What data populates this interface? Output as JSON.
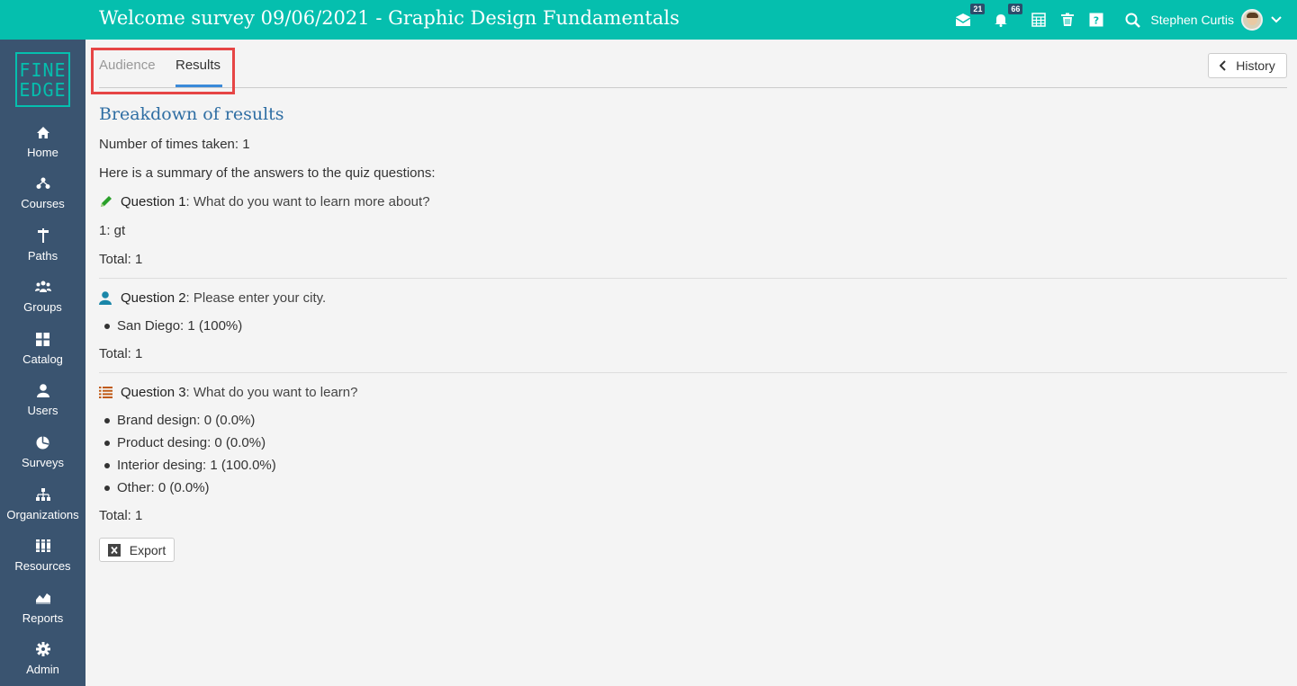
{
  "header": {
    "title": "Welcome survey 09/06/2021 - Graphic Design Fundamentals",
    "messages_badge": "21",
    "notifications_badge": "66",
    "user_name": "Stephen Curtis"
  },
  "logo": {
    "line1": "FINE",
    "line2": "EDGE"
  },
  "sidebar": {
    "items": [
      {
        "label": "Home"
      },
      {
        "label": "Courses"
      },
      {
        "label": "Paths"
      },
      {
        "label": "Groups"
      },
      {
        "label": "Catalog"
      },
      {
        "label": "Users"
      },
      {
        "label": "Surveys"
      },
      {
        "label": "Organizations"
      },
      {
        "label": "Resources"
      },
      {
        "label": "Reports"
      },
      {
        "label": "Admin"
      }
    ]
  },
  "tabs": {
    "audience": "Audience",
    "results": "Results"
  },
  "history_label": "History",
  "results": {
    "title": "Breakdown of results",
    "times_taken": "Number of times taken: 1",
    "summary": "Here is a summary of the answers to the quiz questions:",
    "q1": {
      "label": "Question 1",
      "text": ": What do you want to learn more about?",
      "answer": "1: gt",
      "total": "Total: 1"
    },
    "q2": {
      "label": "Question 2",
      "text": ": Please enter your city.",
      "options": [
        "San Diego: 1 (100%)"
      ],
      "total": "Total: 1"
    },
    "q3": {
      "label": "Question 3",
      "text": ": What do you want to learn?",
      "options": [
        "Brand design: 0 (0.0%)",
        "Product desing: 0 (0.0%)",
        "Interior desing: 1 (100.0%)",
        "Other: 0 (0.0%)"
      ],
      "total": "Total: 1"
    }
  },
  "export_label": "Export",
  "colors": {
    "topbar": "#05bfae",
    "sidebar": "#3a5470",
    "accent": "#2f6ea3",
    "highlight": "#e64545"
  }
}
